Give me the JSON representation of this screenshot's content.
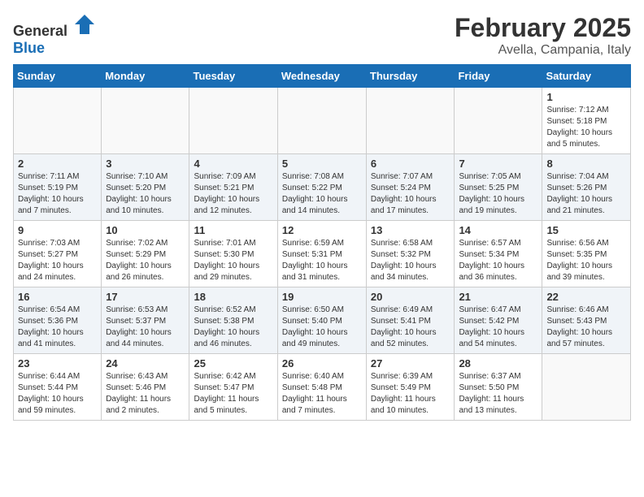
{
  "header": {
    "logo_general": "General",
    "logo_blue": "Blue",
    "month": "February 2025",
    "location": "Avella, Campania, Italy"
  },
  "weekdays": [
    "Sunday",
    "Monday",
    "Tuesday",
    "Wednesday",
    "Thursday",
    "Friday",
    "Saturday"
  ],
  "weeks": [
    [
      {
        "day": "",
        "info": ""
      },
      {
        "day": "",
        "info": ""
      },
      {
        "day": "",
        "info": ""
      },
      {
        "day": "",
        "info": ""
      },
      {
        "day": "",
        "info": ""
      },
      {
        "day": "",
        "info": ""
      },
      {
        "day": "1",
        "info": "Sunrise: 7:12 AM\nSunset: 5:18 PM\nDaylight: 10 hours and 5 minutes."
      }
    ],
    [
      {
        "day": "2",
        "info": "Sunrise: 7:11 AM\nSunset: 5:19 PM\nDaylight: 10 hours and 7 minutes."
      },
      {
        "day": "3",
        "info": "Sunrise: 7:10 AM\nSunset: 5:20 PM\nDaylight: 10 hours and 10 minutes."
      },
      {
        "day": "4",
        "info": "Sunrise: 7:09 AM\nSunset: 5:21 PM\nDaylight: 10 hours and 12 minutes."
      },
      {
        "day": "5",
        "info": "Sunrise: 7:08 AM\nSunset: 5:22 PM\nDaylight: 10 hours and 14 minutes."
      },
      {
        "day": "6",
        "info": "Sunrise: 7:07 AM\nSunset: 5:24 PM\nDaylight: 10 hours and 17 minutes."
      },
      {
        "day": "7",
        "info": "Sunrise: 7:05 AM\nSunset: 5:25 PM\nDaylight: 10 hours and 19 minutes."
      },
      {
        "day": "8",
        "info": "Sunrise: 7:04 AM\nSunset: 5:26 PM\nDaylight: 10 hours and 21 minutes."
      }
    ],
    [
      {
        "day": "9",
        "info": "Sunrise: 7:03 AM\nSunset: 5:27 PM\nDaylight: 10 hours and 24 minutes."
      },
      {
        "day": "10",
        "info": "Sunrise: 7:02 AM\nSunset: 5:29 PM\nDaylight: 10 hours and 26 minutes."
      },
      {
        "day": "11",
        "info": "Sunrise: 7:01 AM\nSunset: 5:30 PM\nDaylight: 10 hours and 29 minutes."
      },
      {
        "day": "12",
        "info": "Sunrise: 6:59 AM\nSunset: 5:31 PM\nDaylight: 10 hours and 31 minutes."
      },
      {
        "day": "13",
        "info": "Sunrise: 6:58 AM\nSunset: 5:32 PM\nDaylight: 10 hours and 34 minutes."
      },
      {
        "day": "14",
        "info": "Sunrise: 6:57 AM\nSunset: 5:34 PM\nDaylight: 10 hours and 36 minutes."
      },
      {
        "day": "15",
        "info": "Sunrise: 6:56 AM\nSunset: 5:35 PM\nDaylight: 10 hours and 39 minutes."
      }
    ],
    [
      {
        "day": "16",
        "info": "Sunrise: 6:54 AM\nSunset: 5:36 PM\nDaylight: 10 hours and 41 minutes."
      },
      {
        "day": "17",
        "info": "Sunrise: 6:53 AM\nSunset: 5:37 PM\nDaylight: 10 hours and 44 minutes."
      },
      {
        "day": "18",
        "info": "Sunrise: 6:52 AM\nSunset: 5:38 PM\nDaylight: 10 hours and 46 minutes."
      },
      {
        "day": "19",
        "info": "Sunrise: 6:50 AM\nSunset: 5:40 PM\nDaylight: 10 hours and 49 minutes."
      },
      {
        "day": "20",
        "info": "Sunrise: 6:49 AM\nSunset: 5:41 PM\nDaylight: 10 hours and 52 minutes."
      },
      {
        "day": "21",
        "info": "Sunrise: 6:47 AM\nSunset: 5:42 PM\nDaylight: 10 hours and 54 minutes."
      },
      {
        "day": "22",
        "info": "Sunrise: 6:46 AM\nSunset: 5:43 PM\nDaylight: 10 hours and 57 minutes."
      }
    ],
    [
      {
        "day": "23",
        "info": "Sunrise: 6:44 AM\nSunset: 5:44 PM\nDaylight: 10 hours and 59 minutes."
      },
      {
        "day": "24",
        "info": "Sunrise: 6:43 AM\nSunset: 5:46 PM\nDaylight: 11 hours and 2 minutes."
      },
      {
        "day": "25",
        "info": "Sunrise: 6:42 AM\nSunset: 5:47 PM\nDaylight: 11 hours and 5 minutes."
      },
      {
        "day": "26",
        "info": "Sunrise: 6:40 AM\nSunset: 5:48 PM\nDaylight: 11 hours and 7 minutes."
      },
      {
        "day": "27",
        "info": "Sunrise: 6:39 AM\nSunset: 5:49 PM\nDaylight: 11 hours and 10 minutes."
      },
      {
        "day": "28",
        "info": "Sunrise: 6:37 AM\nSunset: 5:50 PM\nDaylight: 11 hours and 13 minutes."
      },
      {
        "day": "",
        "info": ""
      }
    ]
  ]
}
